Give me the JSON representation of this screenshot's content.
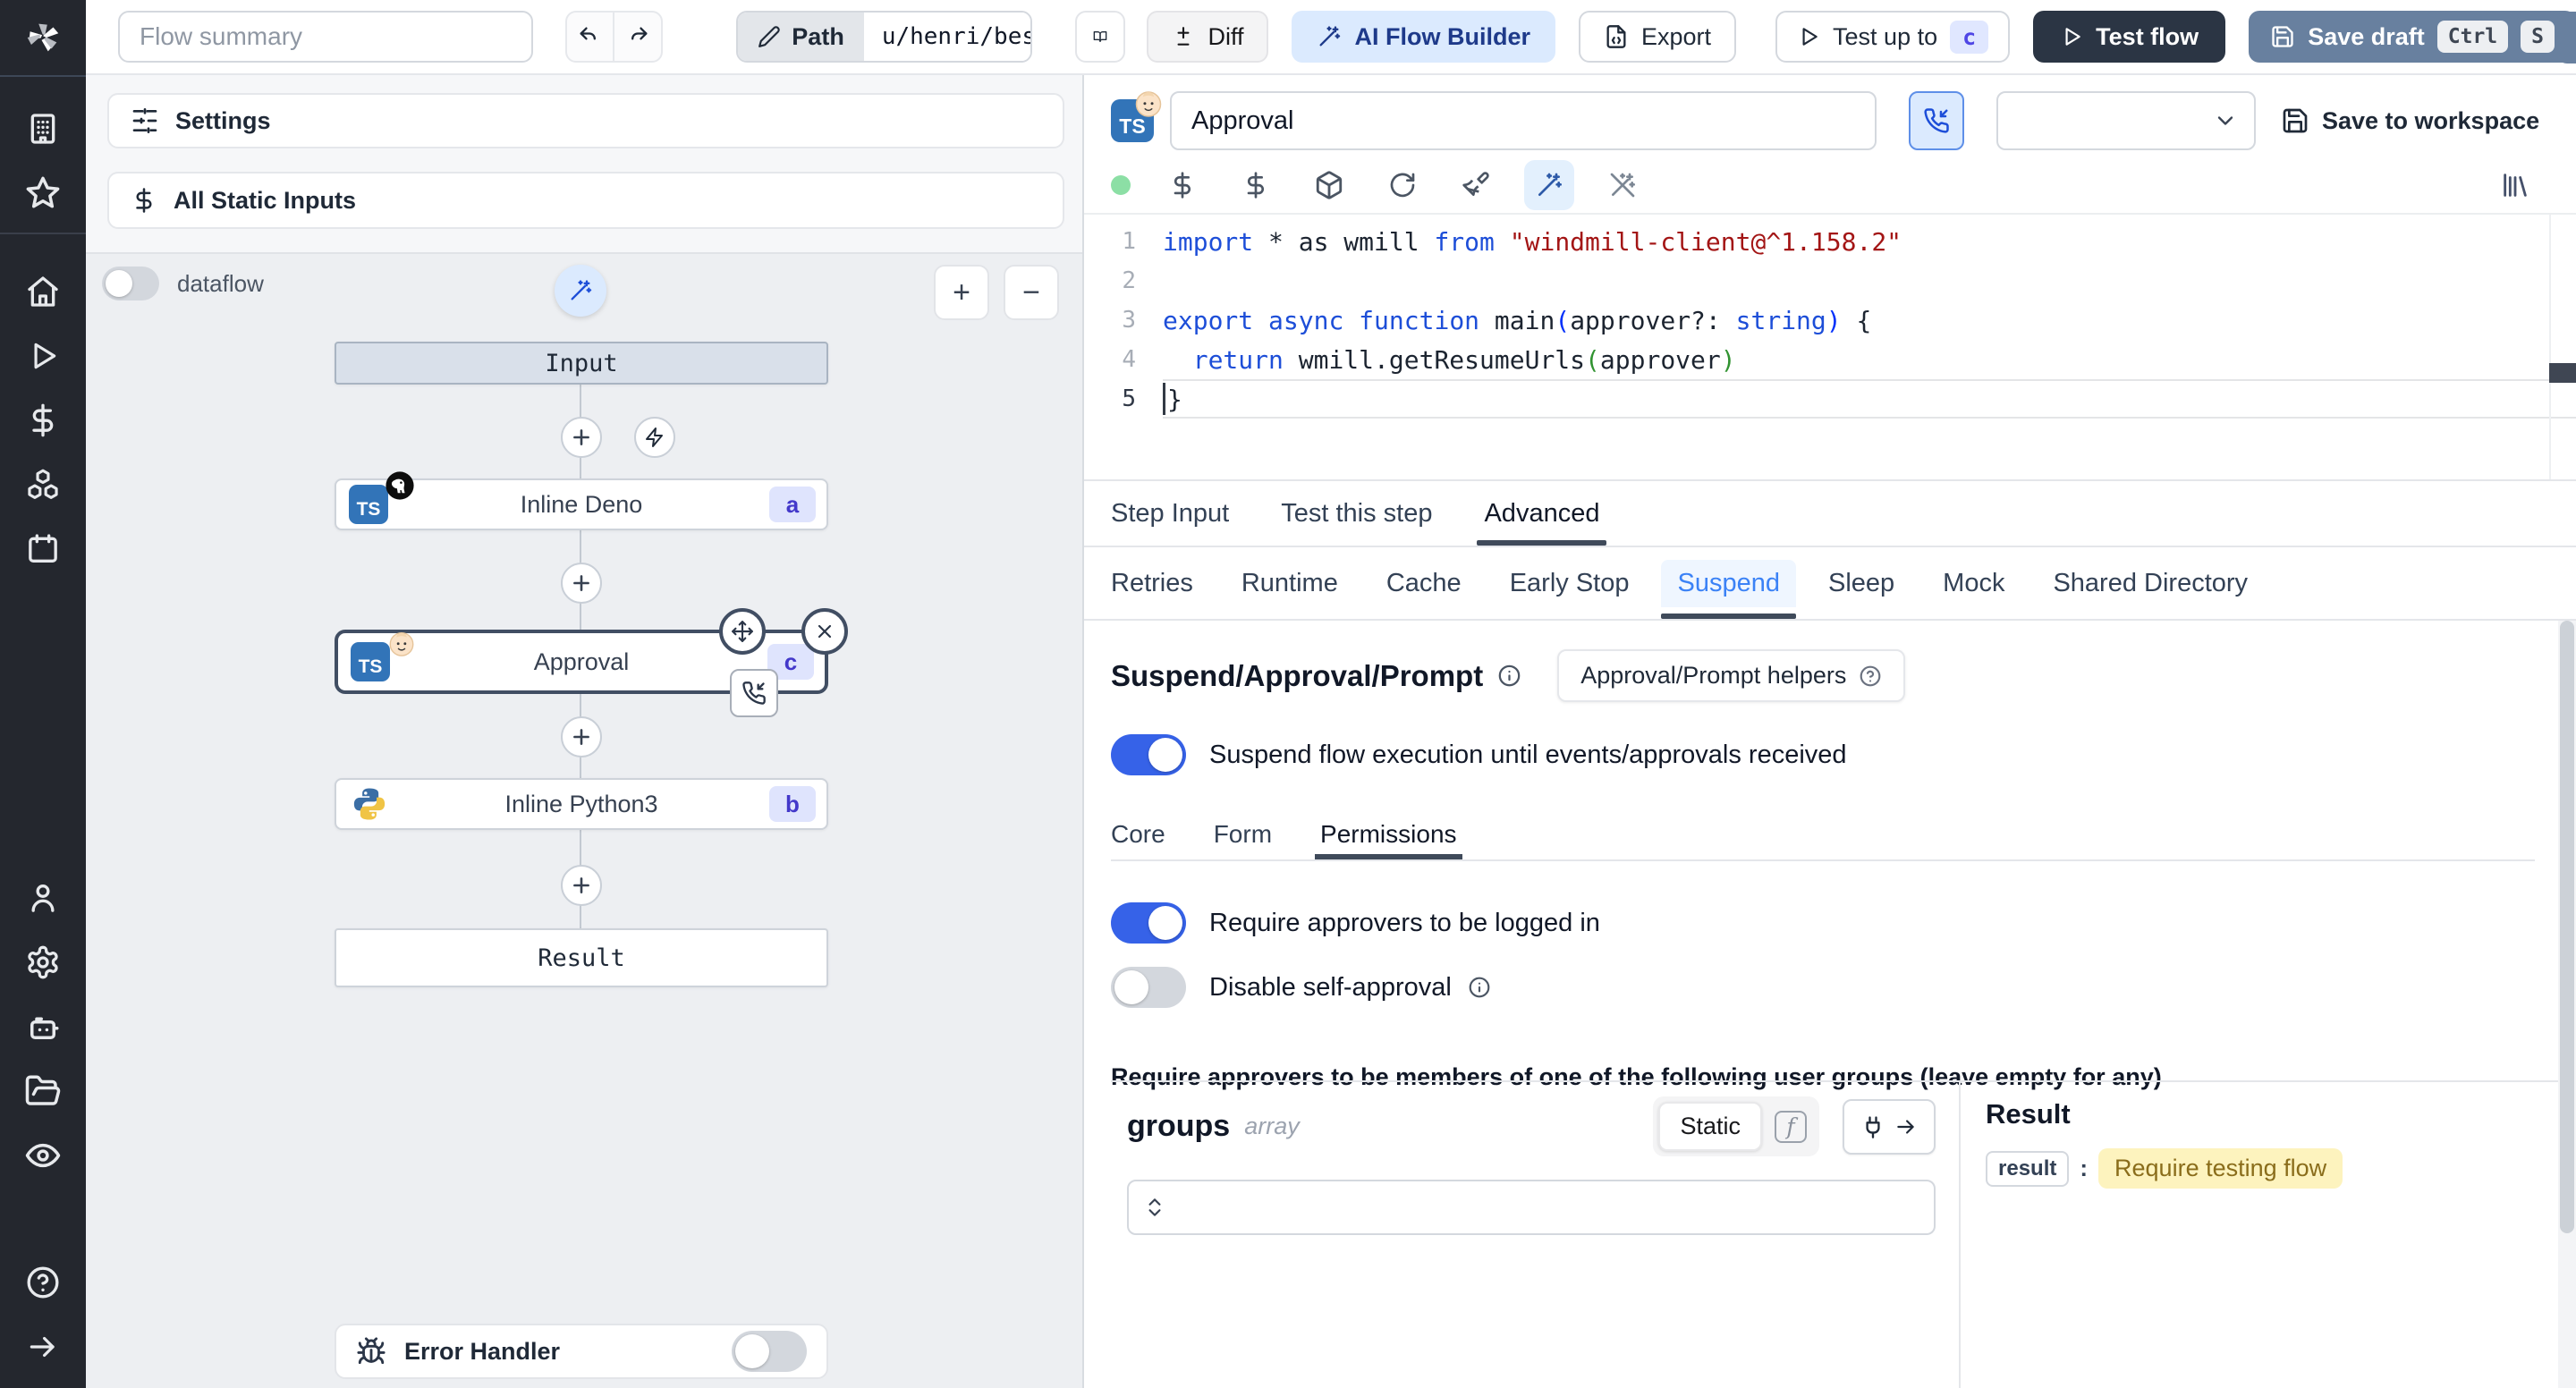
{
  "topbar": {
    "flow_summary_placeholder": "Flow summary",
    "path": {
      "label": "Path",
      "value": "u/henri/bes"
    },
    "diff_label": "Diff",
    "ai_flow_builder_label": "AI Flow Builder",
    "export_label": "Export",
    "test_up_to": {
      "label": "Test up to",
      "badge": "c"
    },
    "test_flow_label": "Test flow",
    "save_draft": {
      "label": "Save draft",
      "kbd": [
        "Ctrl",
        "S"
      ]
    }
  },
  "flow_panel": {
    "settings_label": "Settings",
    "all_static_inputs_label": "All Static Inputs",
    "dataflow_label": "dataflow",
    "graph": {
      "input_label": "Input",
      "steps": [
        {
          "label": "Inline Deno",
          "badge": "a",
          "language": "deno-typescript",
          "selected": false
        },
        {
          "label": "Approval",
          "badge": "c",
          "language": "deno-typescript",
          "selected": true
        },
        {
          "label": "Inline Python3",
          "badge": "b",
          "language": "python3",
          "selected": false
        }
      ],
      "result_label": "Result"
    },
    "error_handler_label": "Error Handler"
  },
  "step_panel": {
    "step_name_value": "Approval",
    "save_to_workspace_label": "Save to workspace",
    "editor": {
      "language": "typescript",
      "lines": [
        {
          "number": 1,
          "tokens": [
            [
              "import",
              "kw"
            ],
            [
              " * as wmill ",
              "pl"
            ],
            [
              "from",
              "kw"
            ],
            [
              " ",
              "pl"
            ],
            [
              "\"windmill-client@^1.158.2\"",
              "str"
            ]
          ]
        },
        {
          "number": 2,
          "tokens": []
        },
        {
          "number": 3,
          "tokens": [
            [
              "export",
              "kw"
            ],
            [
              " ",
              "pl"
            ],
            [
              "async",
              "kw"
            ],
            [
              " ",
              "pl"
            ],
            [
              "function",
              "kw"
            ],
            [
              " main",
              "pl"
            ],
            [
              "(",
              "br1"
            ],
            [
              "approver?: ",
              "pl"
            ],
            [
              "string",
              "kw"
            ],
            [
              ")",
              "br1"
            ],
            [
              " {",
              "pl"
            ]
          ]
        },
        {
          "number": 4,
          "tokens": [
            [
              "  ",
              "pl"
            ],
            [
              "return",
              "kw"
            ],
            [
              " wmill.getResumeUrls",
              "pl"
            ],
            [
              "(",
              "br2"
            ],
            [
              "approver",
              "pl"
            ],
            [
              ")",
              "br2"
            ]
          ]
        },
        {
          "number": 5,
          "tokens": [
            [
              "}",
              "pl"
            ]
          ],
          "current": true
        }
      ]
    },
    "tabs": {
      "items": [
        "Step Input",
        "Test this step",
        "Advanced"
      ],
      "active": "Advanced"
    },
    "advanced_tabs": {
      "items": [
        "Retries",
        "Runtime",
        "Cache",
        "Early Stop",
        "Suspend",
        "Sleep",
        "Mock",
        "Shared Directory"
      ],
      "active": "Suspend"
    },
    "suspend": {
      "title": "Suspend/Approval/Prompt",
      "helpers_button_label": "Approval/Prompt helpers",
      "suspend_toggle": {
        "label": "Suspend flow execution until events/approvals received",
        "on": true
      },
      "tabs": {
        "items": [
          "Core",
          "Form",
          "Permissions"
        ],
        "active": "Permissions"
      },
      "require_logged_in": {
        "label": "Require approvers to be logged in",
        "on": true
      },
      "disable_self_approval": {
        "label": "Disable self-approval",
        "on": false
      },
      "groups_hint": "Require approvers to be members of one of the following user groups (leave empty for any)",
      "groups_field": {
        "name": "groups",
        "type": "array",
        "mode_label": "Static"
      },
      "result_panel": {
        "title": "Result",
        "key": "result",
        "value": "Require testing flow"
      }
    }
  },
  "colors": {
    "sidebar_bg": "#24272e",
    "toggle_on": "#3662e8",
    "step_badge_bg": "#dfe4fd",
    "step_badge_text": "#4338ca",
    "ts_badge_bg": "#3274b8",
    "save_draft_bg": "#68809f",
    "test_flow_bg": "#2b3544",
    "ai_button_bg": "#dbeafe",
    "ai_button_text": "#1e3a8a",
    "suspend_tab_active": "#3b82f6",
    "result_value_bg": "#fdf3be",
    "result_value_text": "#8a6d1b",
    "code_keyword": "#1d4ed8",
    "code_string": "#a31515",
    "status_dot": "#8cdfa5"
  }
}
